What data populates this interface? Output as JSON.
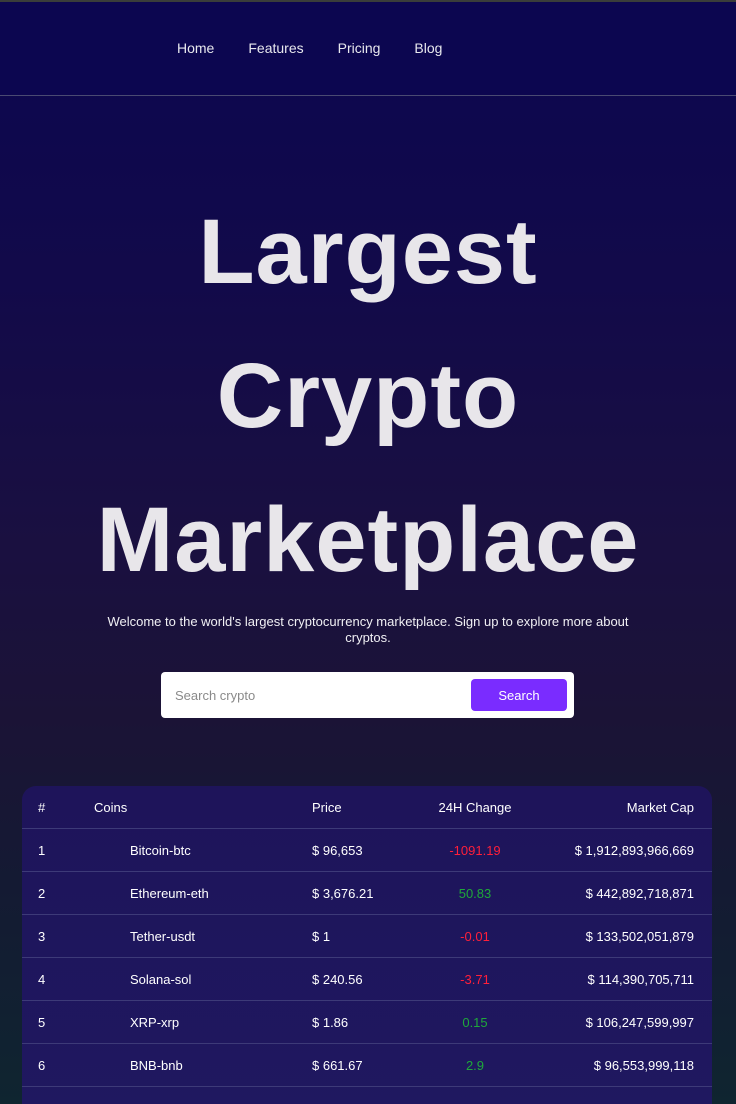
{
  "nav": {
    "items": [
      "Home",
      "Features",
      "Pricing",
      "Blog"
    ]
  },
  "hero": {
    "title_lines": [
      "Largest",
      "Crypto",
      "Marketplace"
    ],
    "subtitle": "Welcome to the world's largest cryptocurrency marketplace. Sign up to explore more about cryptos."
  },
  "search": {
    "placeholder": "Search crypto",
    "button_label": "Search",
    "accent": "#7a2cff"
  },
  "table": {
    "headers": [
      "#",
      "Coins",
      "Price",
      "24H Change",
      "Market Cap"
    ],
    "rows": [
      {
        "rank": "1",
        "coin": "Bitcoin-btc",
        "price": "$ 96,653",
        "change": "-1091.19",
        "direction": "neg",
        "cap": "$ 1,912,893,966,669"
      },
      {
        "rank": "2",
        "coin": "Ethereum-eth",
        "price": "$ 3,676.21",
        "change": "50.83",
        "direction": "pos",
        "cap": "$ 442,892,718,871"
      },
      {
        "rank": "3",
        "coin": "Tether-usdt",
        "price": "$ 1",
        "change": "-0.01",
        "direction": "neg",
        "cap": "$ 133,502,051,879"
      },
      {
        "rank": "4",
        "coin": "Solana-sol",
        "price": "$ 240.56",
        "change": "-3.71",
        "direction": "neg",
        "cap": "$ 114,390,705,711"
      },
      {
        "rank": "5",
        "coin": "XRP-xrp",
        "price": "$ 1.86",
        "change": "0.15",
        "direction": "pos",
        "cap": "$ 106,247,599,997"
      },
      {
        "rank": "6",
        "coin": "BNB-bnb",
        "price": "$ 661.67",
        "change": "2.9",
        "direction": "pos",
        "cap": "$ 96,553,999,118"
      }
    ],
    "colors": {
      "negative": "#ff1f3a",
      "positive": "#1fa83a"
    }
  }
}
